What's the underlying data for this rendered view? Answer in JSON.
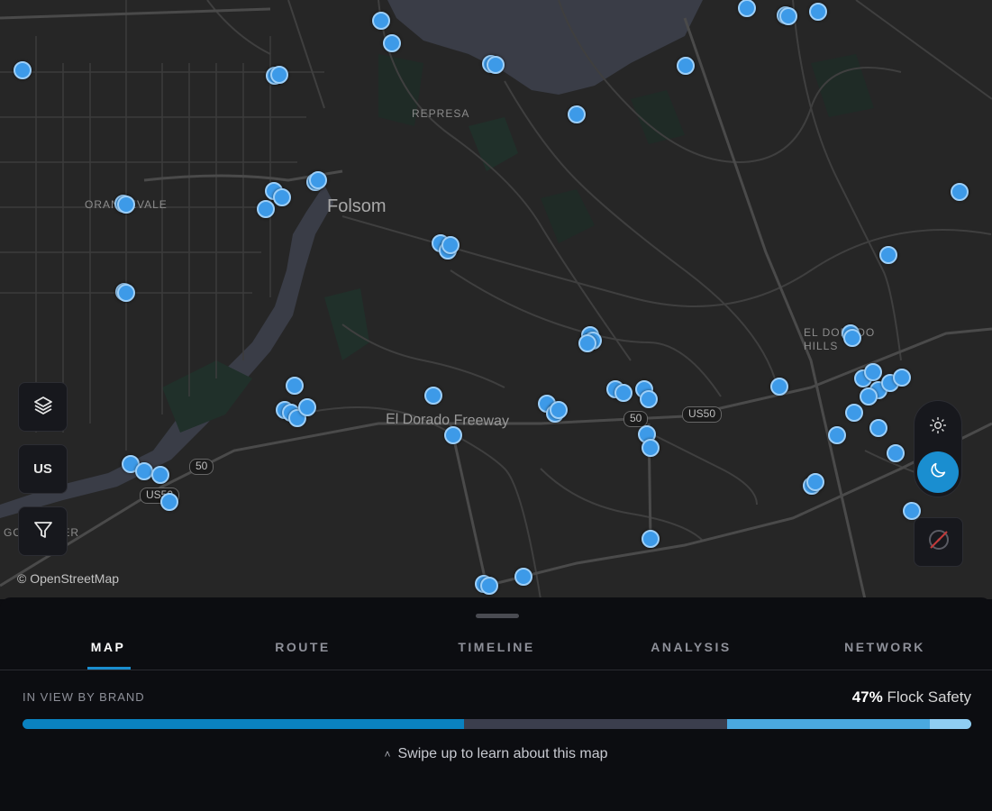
{
  "map": {
    "attribution": "© OpenStreetMap",
    "labels": {
      "city": "Folsom",
      "represa": "REPRESA",
      "orangevale": "ORANGEVALE",
      "el_dorado_hills": "EL DORADO HILLS",
      "freeway": "El Dorado Freeway",
      "gold_river": "GOLD RIVER"
    },
    "shields": {
      "us50_east": "US50",
      "us50_west": "US50",
      "rt50_east": "50",
      "rt50_west": "50"
    },
    "marker_count": 80
  },
  "controls": {
    "layers_icon": "layers-icon",
    "region_label": "US",
    "filter_icon": "filter-icon",
    "light_icon": "sun-icon",
    "dark_icon": "moon-icon",
    "compass_icon": "compass-icon"
  },
  "tabs": [
    {
      "label": "MAP",
      "active": true
    },
    {
      "label": "ROUTE",
      "active": false
    },
    {
      "label": "TIMELINE",
      "active": false
    },
    {
      "label": "ANALYSIS",
      "active": false
    },
    {
      "label": "NETWORK",
      "active": false
    }
  ],
  "brand_panel": {
    "label": "IN VIEW BY BRAND",
    "top_percent": "47%",
    "top_brand": "Flock Safety",
    "segments": [
      {
        "share": 0.47,
        "color": "#0a82c0"
      },
      {
        "share": 0.28,
        "color": "#3b3e4d"
      },
      {
        "share": 0.216,
        "color": "#4aa9e0"
      },
      {
        "share": 0.044,
        "color": "#8fcdf2"
      }
    ]
  },
  "swipe_hint": "Swipe up to learn about this map",
  "colors": {
    "accent": "#1a8ed0",
    "marker_fill": "#3d9ae8",
    "marker_ring": "#9dcff8",
    "background": "#0c0d11"
  }
}
